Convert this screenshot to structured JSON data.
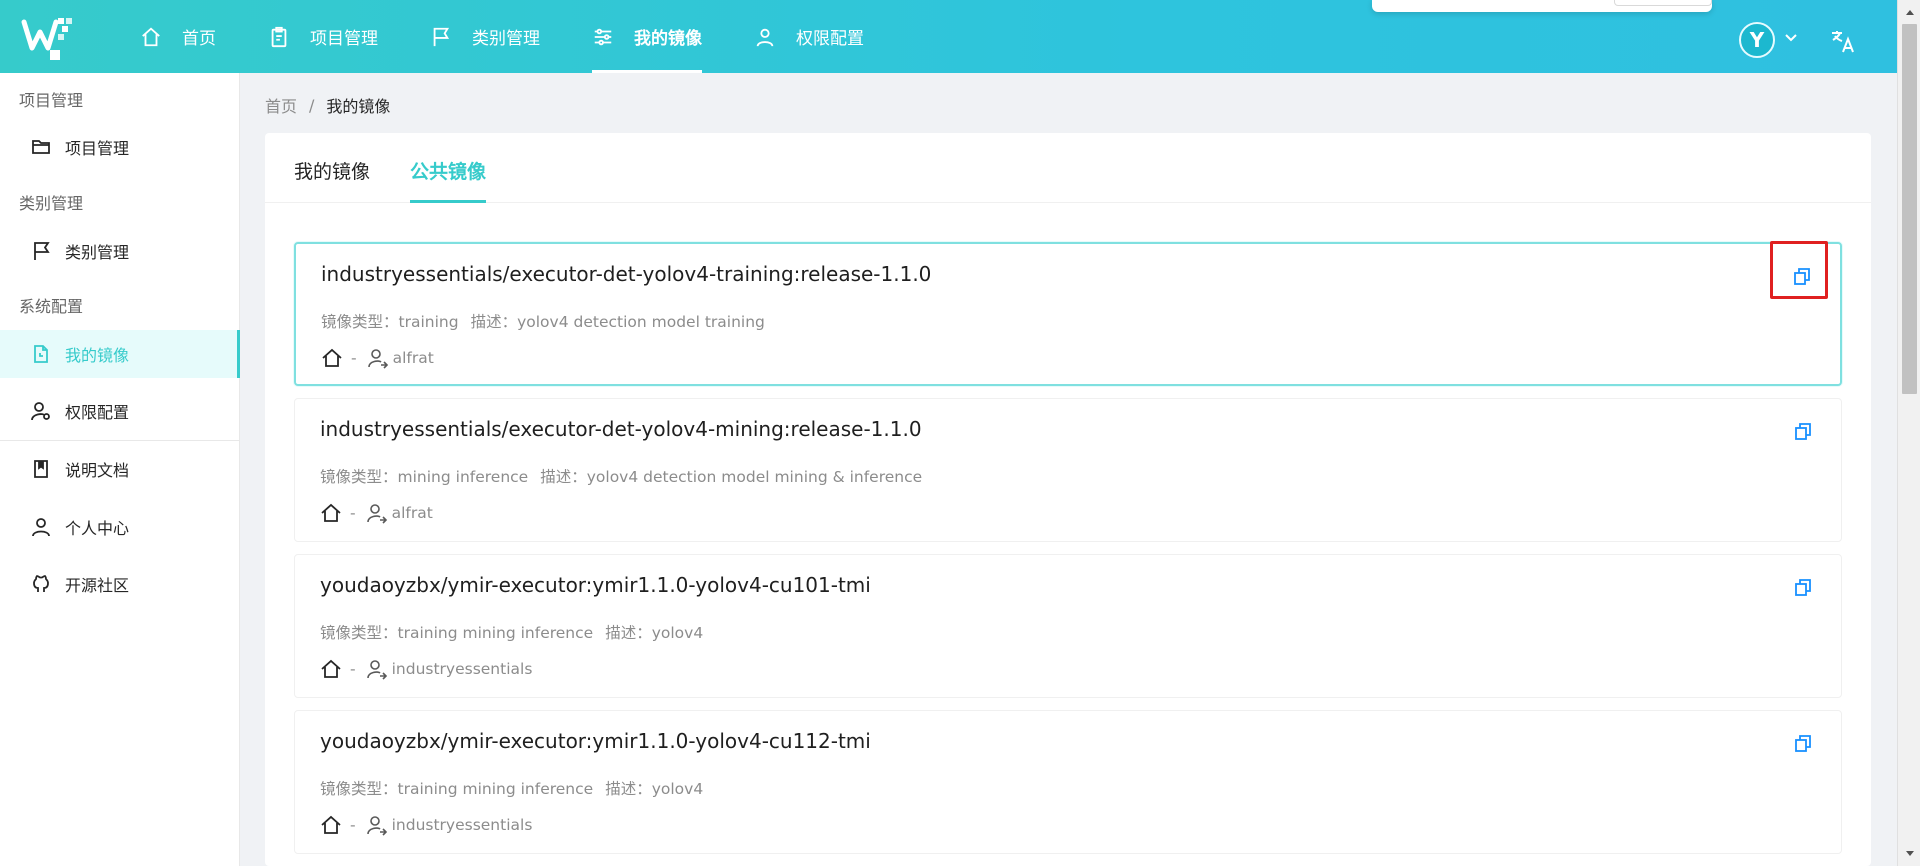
{
  "header": {
    "nav": [
      {
        "label": "首页",
        "icon": "home-icon"
      },
      {
        "label": "项目管理",
        "icon": "clipboard-icon"
      },
      {
        "label": "类别管理",
        "icon": "flag-icon"
      },
      {
        "label": "我的镜像",
        "icon": "sliders-icon",
        "active": true
      },
      {
        "label": "权限配置",
        "icon": "user-icon"
      }
    ],
    "avatar_letter": "Y"
  },
  "sidebar": {
    "groups": [
      {
        "title": "项目管理"
      },
      {
        "title": "类别管理"
      },
      {
        "title": "系统配置"
      }
    ],
    "items": [
      {
        "label": "项目管理",
        "icon": "folder-icon"
      },
      {
        "label": "类别管理",
        "icon": "flag-icon"
      },
      {
        "label": "我的镜像",
        "icon": "file-clock-icon",
        "active": true
      },
      {
        "label": "权限配置",
        "icon": "user-settings-icon"
      },
      {
        "label": "说明文档",
        "icon": "book-icon"
      },
      {
        "label": "个人中心",
        "icon": "user-icon"
      },
      {
        "label": "开源社区",
        "icon": "github-icon"
      }
    ]
  },
  "breadcrumb": {
    "home": "首页",
    "separator": "/",
    "current": "我的镜像"
  },
  "tabs": [
    {
      "label": "我的镜像"
    },
    {
      "label": "公共镜像",
      "active": true
    }
  ],
  "labels": {
    "type": "镜像类型：",
    "desc": "描述：",
    "dash": "-"
  },
  "images": [
    {
      "name": "industryessentials/executor-det-yolov4-training:release-1.1.0",
      "type": "training",
      "desc": "yolov4 detection model training",
      "owner": "alfrat"
    },
    {
      "name": "industryessentials/executor-det-yolov4-mining:release-1.1.0",
      "type": "mining inference",
      "desc": "yolov4 detection model mining & inference",
      "owner": "alfrat"
    },
    {
      "name": "youdaoyzbx/ymir-executor:ymir1.1.0-yolov4-cu101-tmi",
      "type": "training mining inference",
      "desc": "yolov4",
      "owner": "industryessentials"
    },
    {
      "name": "youdaoyzbx/ymir-executor:ymir1.1.0-yolov4-cu112-tmi",
      "type": "training mining inference",
      "desc": "yolov4",
      "owner": "industryessentials"
    }
  ],
  "colors": {
    "brand": "#36cbcb",
    "copy_icon": "#1890ff",
    "highlight_box": "#e02020"
  }
}
